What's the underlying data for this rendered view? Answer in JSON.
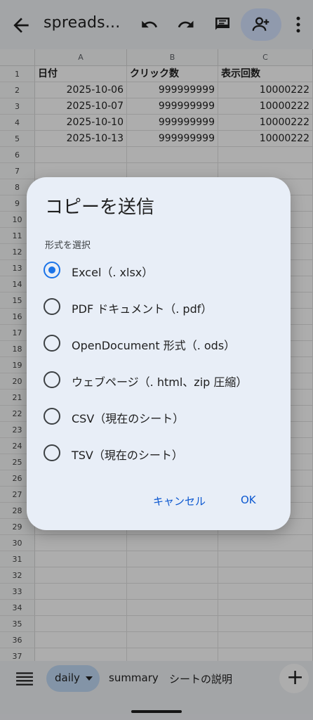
{
  "appbar": {
    "title": "spreads...",
    "icons": [
      "back-arrow-icon",
      "undo-icon",
      "redo-icon",
      "comment-icon",
      "add-person-icon",
      "more-vert-icon"
    ]
  },
  "grid": {
    "columns": [
      "A",
      "B",
      "C"
    ],
    "rows": [
      "1",
      "2",
      "3",
      "4",
      "5",
      "6",
      "7",
      "8",
      "9",
      "10",
      "11",
      "12",
      "13",
      "14",
      "15",
      "16",
      "17",
      "18",
      "19",
      "20",
      "21",
      "22",
      "23",
      "24",
      "25",
      "26",
      "27",
      "28",
      "29",
      "30",
      "31",
      "32",
      "33",
      "34",
      "35",
      "36",
      "37"
    ],
    "header_cells": [
      "日付",
      "クリック数",
      "表示回数"
    ],
    "data": [
      [
        "2025-10-06",
        "999999999",
        "10000222"
      ],
      [
        "2025-10-07",
        "999999999",
        "10000222"
      ],
      [
        "2025-10-10",
        "999999999",
        "10000222"
      ],
      [
        "2025-10-13",
        "999999999",
        "10000222"
      ]
    ]
  },
  "tabs": {
    "active": "daily",
    "others": [
      "summary",
      "シートの説明"
    ],
    "fab": "+"
  },
  "dialog": {
    "title": "コピーを送信",
    "subtitle": "形式を選択",
    "options": [
      "Excel（. xlsx）",
      "PDF ドキュメント（. pdf）",
      "OpenDocument 形式（. ods）",
      "ウェブページ（. html、zip 圧縮）",
      "CSV（現在のシート）",
      "TSV（現在のシート）"
    ],
    "selected_index": 0,
    "cancel_label": "キャンセル",
    "ok_label": "OK"
  },
  "colors": {
    "accent": "#1a73e8",
    "dialog_bg": "#e8eef7",
    "active_tab": "#c2dbf7"
  }
}
